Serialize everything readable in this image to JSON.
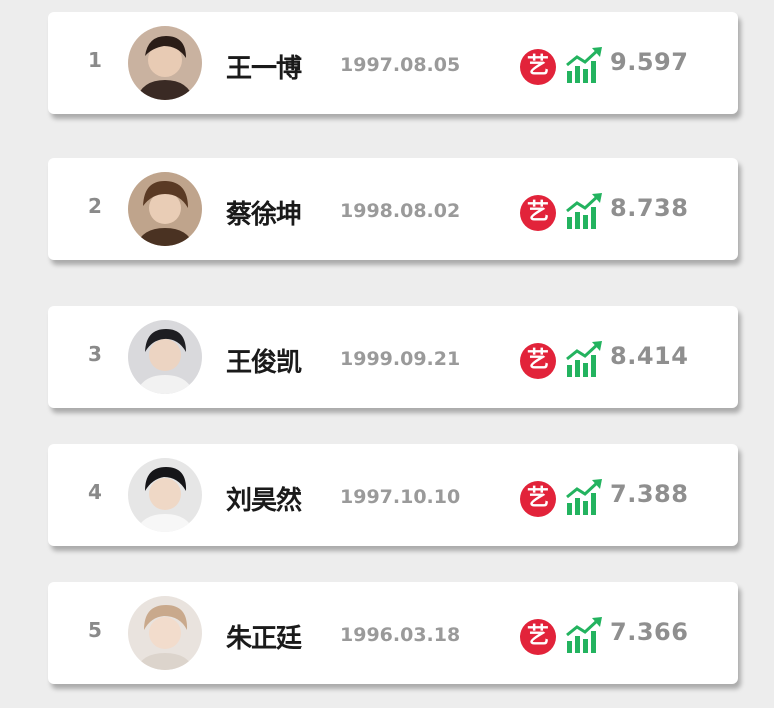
{
  "badge_color": "#e2233a",
  "trend_color": "#23b35f",
  "trend_icon": "trending-up-icon",
  "ranking": [
    {
      "rank": "1",
      "name": "王一博",
      "birth_date": "1997.08.05",
      "badge": "艺",
      "score": "9.597",
      "avatar_tone": "#3a2a24"
    },
    {
      "rank": "2",
      "name": "蔡徐坤",
      "birth_date": "1998.08.02",
      "badge": "艺",
      "score": "8.738",
      "avatar_tone": "#4a3222"
    },
    {
      "rank": "3",
      "name": "王俊凯",
      "birth_date": "1999.09.21",
      "badge": "艺",
      "score": "8.414",
      "avatar_tone": "#2a2a2e"
    },
    {
      "rank": "4",
      "name": "刘昊然",
      "birth_date": "1997.10.10",
      "badge": "艺",
      "score": "7.388",
      "avatar_tone": "#1f1f22"
    },
    {
      "rank": "5",
      "name": "朱正廷",
      "birth_date": "1996.03.18",
      "badge": "艺",
      "score": "7.366",
      "avatar_tone": "#b59a7e"
    }
  ]
}
